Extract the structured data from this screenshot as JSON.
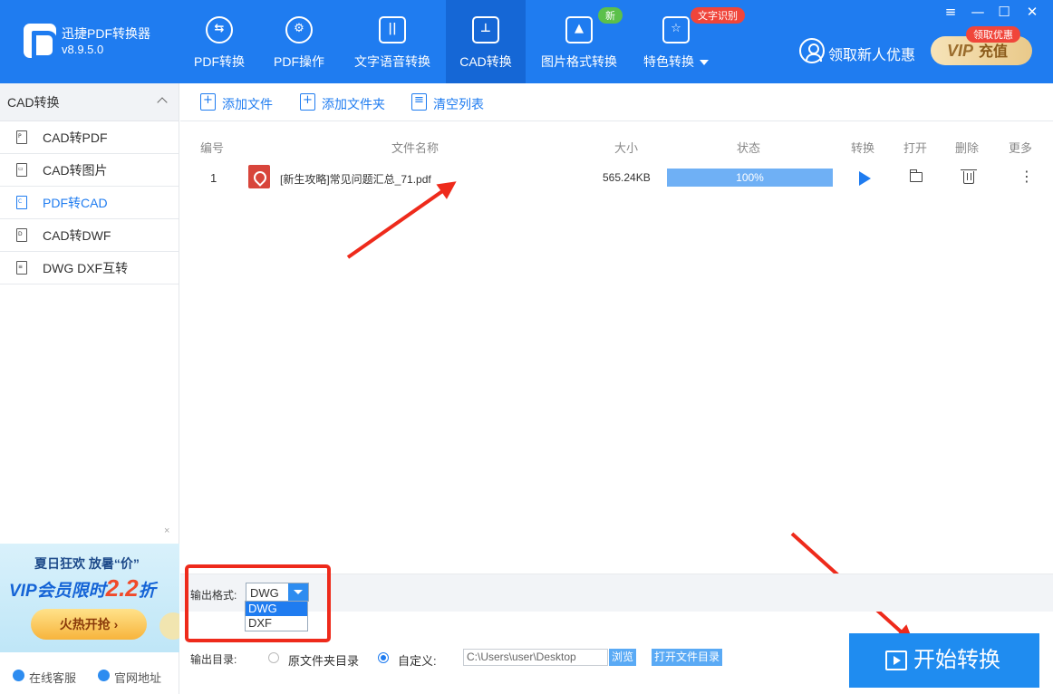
{
  "app": {
    "name": "迅捷PDF转换器",
    "version": "v8.9.5.0"
  },
  "nav": [
    {
      "label": "PDF转换",
      "icon": "pdf-convert-icon",
      "glyph": "⇆"
    },
    {
      "label": "PDF操作",
      "icon": "pdf-operate-icon",
      "glyph": "⚙"
    },
    {
      "label": "文字语音转换",
      "icon": "audio-wave-icon",
      "glyph": "||"
    },
    {
      "label": "CAD转换",
      "icon": "cad-icon",
      "glyph": "⊥"
    },
    {
      "label": "图片格式转换",
      "icon": "image-icon",
      "glyph": "▲"
    },
    {
      "label": "特色转换",
      "icon": "feature-icon",
      "glyph": "☆"
    }
  ],
  "badges": {
    "new": "新",
    "ocr": "文字识别",
    "vip_tag": "领取优惠"
  },
  "header": {
    "promo": "领取新人优惠",
    "vip": "VIP",
    "recharge": "充值"
  },
  "window": {
    "menu": "≡",
    "minimize": "—",
    "maximize": "☐",
    "close": "✕"
  },
  "sidebar": {
    "section": "CAD转换",
    "items": [
      {
        "label": "CAD转PDF",
        "tag": "P"
      },
      {
        "label": "CAD转图片",
        "tag": "▭"
      },
      {
        "label": "PDF转CAD",
        "tag": "C"
      },
      {
        "label": "CAD转DWF",
        "tag": "D"
      },
      {
        "label": "DWG DXF互转",
        "tag": "≡"
      }
    ],
    "ad": {
      "line1": "夏日狂欢 放暑“价”",
      "line2_pre": "VIP会员限时",
      "line2_num": "2.2",
      "line2_post": "折",
      "cta": "火热开抢 ›",
      "close": "×"
    },
    "footer": {
      "service": "在线客服",
      "site": "官网地址"
    }
  },
  "toolbar": {
    "add_file": "添加文件",
    "add_folder": "添加文件夹",
    "clear": "清空列表"
  },
  "table": {
    "headers": {
      "no": "编号",
      "name": "文件名称",
      "size": "大小",
      "status": "状态",
      "convert": "转换",
      "open": "打开",
      "delete": "删除",
      "more": "更多"
    },
    "rows": [
      {
        "no": "1",
        "name": "[新生攻略]常见问题汇总_71.pdf",
        "size": "565.24KB",
        "progress": 1.0,
        "progress_text": "100%"
      }
    ]
  },
  "output": {
    "format_label": "输出格式:",
    "format_value": "DWG",
    "format_options": [
      "DWG",
      "DXF"
    ],
    "dir_label": "输出目录:",
    "dir_option_original": "原文件夹目录",
    "dir_option_custom": "自定义:",
    "path": "C:\\Users\\user\\Desktop",
    "browse": "浏览",
    "open_dir": "打开文件目录"
  },
  "start_button": "开始转换",
  "colors": {
    "primary": "#1f7cf0",
    "annotation_red": "#ee2a1b",
    "progress": "#6fb0f5"
  }
}
